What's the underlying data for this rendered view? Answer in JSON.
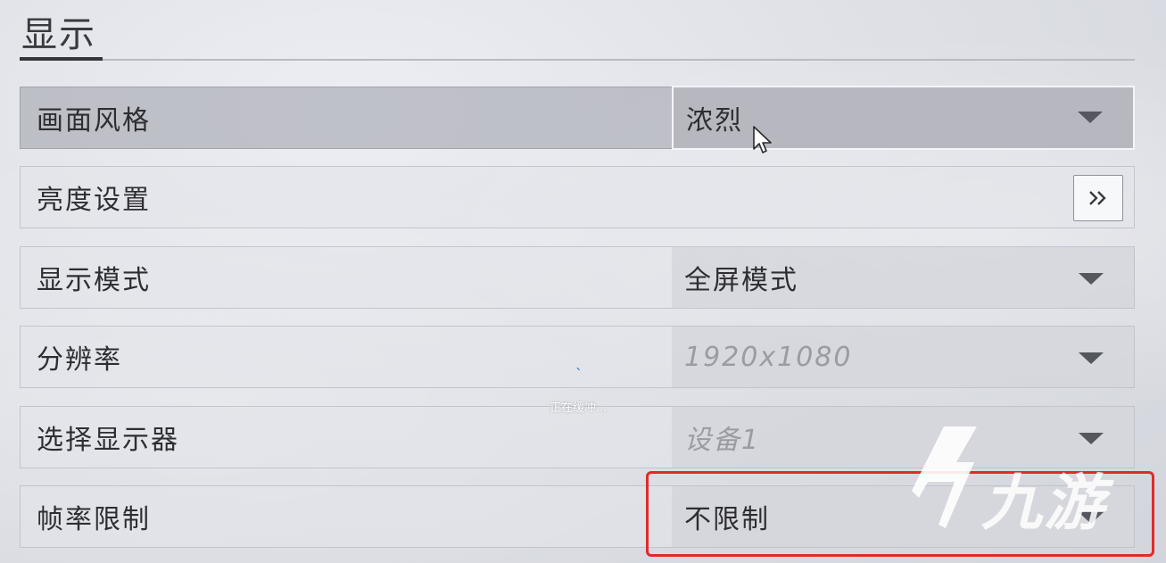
{
  "section": {
    "title": "显示"
  },
  "settings": {
    "style": {
      "label": "画面风格",
      "value": "浓烈"
    },
    "brightness": {
      "label": "亮度设置",
      "button_glyph": "»"
    },
    "display_mode": {
      "label": "显示模式",
      "value": "全屏模式"
    },
    "resolution": {
      "label": "分辨率",
      "value": "1920x1080"
    },
    "monitor": {
      "label": "选择显示器",
      "value": "设备1"
    },
    "framerate": {
      "label": "帧率限制",
      "value": "不限制"
    }
  },
  "overlay": {
    "buffering_text": "正在缓冲...",
    "watermark_text": "九游"
  },
  "colors": {
    "highlight_border": "#e12a2a",
    "selected_row": "#b7b8bf"
  }
}
